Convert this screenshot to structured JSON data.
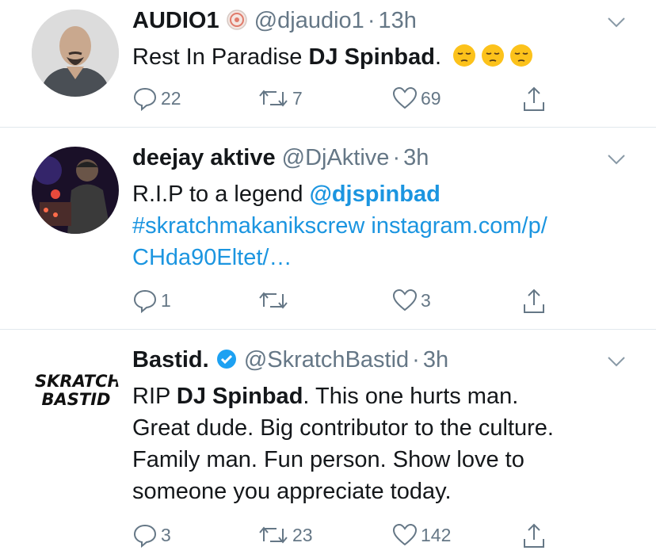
{
  "tweets": [
    {
      "name": "AUDIO1",
      "handle": "@djaudio1",
      "sep": "·",
      "time": "13h",
      "text": {
        "a": "Rest In Paradise ",
        "b": "DJ Spinbad",
        "c": "."
      },
      "replies": "22",
      "retweets": "7",
      "likes": "69"
    },
    {
      "name": "deejay aktive",
      "handle": "@DjAktive",
      "sep": "·",
      "time": "3h",
      "text": {
        "a": "R.I.P to a legend ",
        "mention": "@djspinbad",
        "hashtag": "#skratchmakanikscrew",
        "link1": "instagram.com/p/",
        "link2": "CHda90Eltet/…"
      },
      "replies": "1",
      "retweets": "",
      "likes": "3"
    },
    {
      "name": "Bastid.",
      "handle": "@SkratchBastid",
      "sep": "·",
      "time": "3h",
      "avatar_text": {
        "line1": "SKRATCH",
        "line2": "BASTID"
      },
      "text": {
        "a": "RIP ",
        "b": "DJ Spinbad",
        "c": ". This one hurts man.",
        "line2": "Great dude. Big contributor to the culture.",
        "line3": "Family man. Fun person. Show love to",
        "line4": "someone you appreciate today."
      },
      "replies": "3",
      "retweets": "23",
      "likes": "142"
    }
  ],
  "colors": {
    "link": "#1b95e0",
    "muted": "#657786",
    "verified": "#1da1f2",
    "divider": "#e1e8ed"
  }
}
